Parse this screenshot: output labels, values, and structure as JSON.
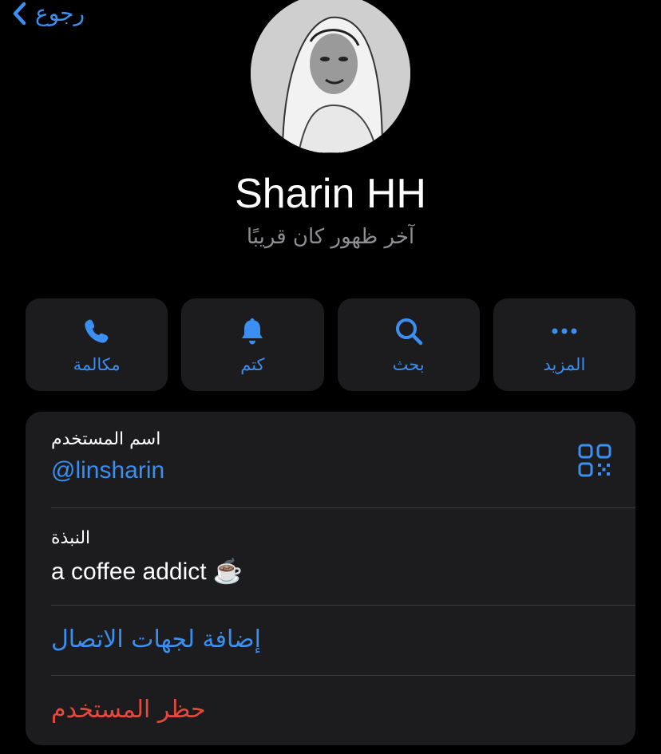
{
  "nav": {
    "back_label": "رجوع"
  },
  "profile": {
    "name": "Sharin HH",
    "status": "آخر ظهور كان قريبًا"
  },
  "actions": [
    {
      "label": "مكالمة",
      "icon": "phone-icon"
    },
    {
      "label": "كتم",
      "icon": "bell-icon"
    },
    {
      "label": "بحث",
      "icon": "search-icon"
    },
    {
      "label": "المزيد",
      "icon": "more-icon"
    }
  ],
  "info": {
    "username_label": "اسم المستخدم",
    "username": "@linsharin",
    "bio_label": "النبذة",
    "bio": "a coffee addict ☕",
    "add_contact": "إضافة لجهات الاتصال",
    "block_user": "حظر المستخدم"
  },
  "colors": {
    "accent": "#3a8ff0",
    "danger": "#e5483c",
    "card": "#1c1c1e",
    "background": "#000000"
  }
}
